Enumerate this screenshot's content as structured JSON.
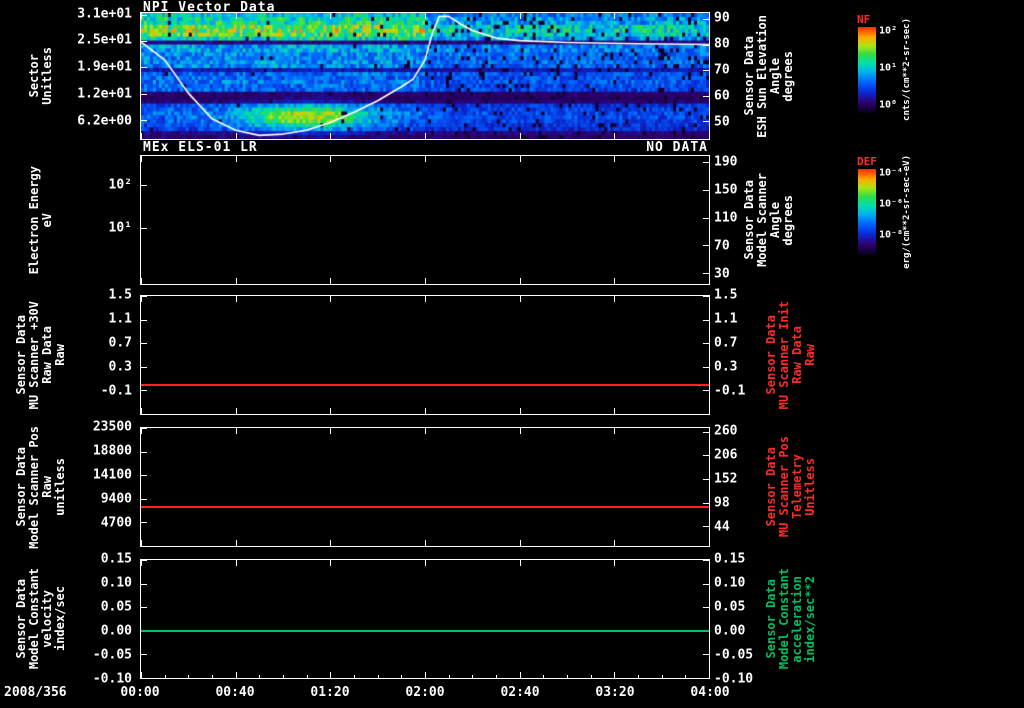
{
  "x_axis": {
    "date_label": "2008/356",
    "ticks": [
      {
        "t": "00:00",
        "p": 0
      },
      {
        "t": "00:40",
        "p": 16.67
      },
      {
        "t": "01:20",
        "p": 33.33
      },
      {
        "t": "02:00",
        "p": 50
      },
      {
        "t": "02:40",
        "p": 66.67
      },
      {
        "t": "03:20",
        "p": 83.33
      },
      {
        "t": "04:00",
        "p": 100
      }
    ]
  },
  "panels": [
    {
      "title": "NPI Vector Data",
      "left_label": [
        "Sector",
        "Unitless"
      ],
      "left_ticks": [
        {
          "t": "3.1e+01",
          "p": 1.6
        },
        {
          "t": "2.5e+01",
          "p": 21.9
        },
        {
          "t": "1.9e+01",
          "p": 43
        },
        {
          "t": "1.2e+01",
          "p": 64
        },
        {
          "t": "6.2e+00",
          "p": 85
        }
      ],
      "right_ticks": [
        {
          "t": "90",
          "p": 4.7
        },
        {
          "t": "80",
          "p": 25
        },
        {
          "t": "70",
          "p": 45.3
        },
        {
          "t": "60",
          "p": 65.6
        },
        {
          "t": "50",
          "p": 86
        }
      ],
      "right_label": [
        "Sensor Data",
        "ESH Sun Elevation",
        "Angle",
        "degrees"
      ],
      "right_label_color": "#ffffff"
    },
    {
      "title": "MEx ELS-01 LR",
      "status": "NO DATA",
      "left_label": [
        "Electron Energy",
        "eV"
      ],
      "left_ticks": [
        {
          "t": "10²",
          "p": 23
        },
        {
          "t": "10¹",
          "p": 56
        }
      ],
      "right_ticks": [
        {
          "t": "190",
          "p": 5
        },
        {
          "t": "150",
          "p": 26.6
        },
        {
          "t": "110",
          "p": 48.2
        },
        {
          "t": "70",
          "p": 69.8
        },
        {
          "t": "30",
          "p": 91.4
        }
      ],
      "right_label": [
        "Sensor Data",
        "Model Scanner",
        "Angle",
        "degrees"
      ],
      "right_label_color": "#ffffff"
    },
    {
      "left_label": [
        "Sensor Data",
        "MU Scanner +30V",
        "Raw Data",
        "Raw"
      ],
      "left_ticks": [
        {
          "t": "1.5",
          "p": 0
        },
        {
          "t": "1.1",
          "p": 20
        },
        {
          "t": "0.7",
          "p": 40
        },
        {
          "t": "0.3",
          "p": 60
        },
        {
          "t": "-0.1",
          "p": 80
        }
      ],
      "right_ticks": [
        {
          "t": "1.5",
          "p": 0
        },
        {
          "t": "1.1",
          "p": 20
        },
        {
          "t": "0.7",
          "p": 40
        },
        {
          "t": "0.3",
          "p": 60
        },
        {
          "t": "-0.1",
          "p": 80
        }
      ],
      "right_label": [
        "Sensor Data",
        "MU Scanner Init",
        "Raw Data",
        "Raw"
      ],
      "right_label_color": "#ff2a2a",
      "line": {
        "value": 0.0,
        "top": 1.5,
        "bottom": -0.5,
        "color": "#ff2020"
      }
    },
    {
      "left_label": [
        "Sensor Data",
        "Model Scanner Pos",
        "Raw",
        "unitless"
      ],
      "left_ticks": [
        {
          "t": "23500",
          "p": 0
        },
        {
          "t": "18800",
          "p": 20
        },
        {
          "t": "14100",
          "p": 40
        },
        {
          "t": "9400",
          "p": 60
        },
        {
          "t": "4700",
          "p": 80
        }
      ],
      "right_ticks": [
        {
          "t": "260",
          "p": 3.3
        },
        {
          "t": "206",
          "p": 23.3
        },
        {
          "t": "152",
          "p": 43.3
        },
        {
          "t": "98",
          "p": 63.3
        },
        {
          "t": "44",
          "p": 83.3
        }
      ],
      "right_label": [
        "Sensor Data",
        "MU Scanner Pos",
        "Telemetry",
        "Unitless"
      ],
      "right_label_color": "#ff2a2a",
      "line": {
        "value": 7800,
        "top": 23500,
        "bottom": 0,
        "color": "#ff2020"
      }
    },
    {
      "left_label": [
        "Sensor Data",
        "Model Constant",
        "velocity",
        "index/sec"
      ],
      "left_ticks": [
        {
          "t": "0.15",
          "p": 0
        },
        {
          "t": "0.10",
          "p": 20
        },
        {
          "t": "0.05",
          "p": 40
        },
        {
          "t": "0.00",
          "p": 60
        },
        {
          "t": "-0.05",
          "p": 80
        },
        {
          "t": "-0.10",
          "p": 100
        }
      ],
      "right_ticks": [
        {
          "t": "0.15",
          "p": 0
        },
        {
          "t": "0.10",
          "p": 20
        },
        {
          "t": "0.05",
          "p": 40
        },
        {
          "t": "0.00",
          "p": 60
        },
        {
          "t": "-0.05",
          "p": 80
        },
        {
          "t": "-0.10",
          "p": 100
        }
      ],
      "right_label": [
        "Sensor Data",
        "Model Constant",
        "acceleration",
        "index/sec**2"
      ],
      "right_label_color": "#00c060",
      "line": {
        "value": 0.0,
        "top": 0.15,
        "bottom": -0.1,
        "color": "#00c060"
      }
    }
  ],
  "colorbars": [
    {
      "name": "NF",
      "unit": "cnts/(cm**2-sr-sec)",
      "ticks": [
        {
          "t": "10²",
          "p": 0
        },
        {
          "t": "10¹",
          "p": 43
        },
        {
          "t": "10⁰",
          "p": 86
        }
      ]
    },
    {
      "name": "DEF",
      "unit": "erg/(cm**2-sr-sec-eV)",
      "ticks": [
        {
          "t": "10⁻⁴",
          "p": 0
        },
        {
          "t": "10⁻⁶",
          "p": 36
        },
        {
          "t": "10⁻⁸",
          "p": 72
        }
      ]
    }
  ],
  "chart_data": [
    {
      "type": "heatmap",
      "title": "NPI Vector Data",
      "ylabel": "Sector (Unitless)",
      "y_range": [
        0,
        32
      ],
      "y_tick_values": [
        31,
        24.8,
        18.6,
        12.4,
        6.2
      ],
      "x_time_range": [
        "00:00",
        "04:00"
      ],
      "date": "2008/356",
      "colorbar": {
        "name": "NF",
        "unit": "cnts/(cm**2-sr-sec)"
      },
      "right_axis": {
        "label": "Sensor Data ESH Sun Elevation Angle (degrees)",
        "ticks": [
          90,
          80,
          70,
          60,
          50
        ]
      },
      "heatmap_description": "32-sector ion count spectrogram: bright cyan band sectors 25-31 before 02:00; bright green-cyan blob sectors 1-9 between 00:20 and 01:30; dark stripes near sectors 9-11, 17 and 24; flatter blue field with black dropout speckle after 02:00",
      "overlay_line": {
        "name": "ESH Sun Elevation Angle",
        "color": "#ffffff",
        "x_minutes": [
          0,
          10,
          20,
          30,
          40,
          50,
          60,
          70,
          80,
          90,
          100,
          110,
          115,
          120,
          123,
          126,
          130,
          135,
          140,
          150,
          160,
          180,
          210,
          240
        ],
        "y_degrees": [
          81,
          74,
          61,
          51,
          46.5,
          44.5,
          45,
          46.5,
          49.5,
          53.5,
          58,
          63.5,
          66.5,
          74,
          84,
          91,
          91,
          88,
          85.5,
          82.5,
          81.5,
          80.8,
          80.3,
          80
        ]
      },
      "render": {
        "seed": 42,
        "cols": 190,
        "rows": 32,
        "band_gain": [
          0.12,
          0.15,
          0.28,
          0.3,
          0.33,
          0.35,
          0.35,
          0.33,
          0.3,
          0.12,
          0.1,
          0.12,
          0.34,
          0.36,
          0.38,
          0.36,
          0.36,
          0.2,
          0.4,
          0.42,
          0.4,
          0.42,
          0.45,
          0.45,
          0.14,
          0.5,
          0.6,
          0.66,
          0.62,
          0.52,
          0.5,
          0.45
        ],
        "blob": {
          "t_center": 0.29,
          "t_sigma": 0.11,
          "row_center": 5,
          "row_sigma": 3.2,
          "gain": 0.46
        },
        "right_dim_after_t": 0.5,
        "speckle_prob": 0.08
      }
    },
    {
      "type": "heatmap",
      "title": "MEx ELS-01 LR",
      "status": "NO DATA",
      "values": [],
      "ylabel": "Electron Energy (eV)",
      "y_ticks": [
        "10²",
        "10¹"
      ],
      "right_axis": {
        "label": "Sensor Data Model Scanner Angle (degrees)",
        "ticks": [
          190,
          150,
          110,
          70,
          30
        ]
      },
      "colorbar": {
        "name": "DEF",
        "unit": "erg/(cm**2-sr-sec-eV)"
      }
    },
    {
      "type": "line",
      "ylabel": "Sensor Data MU Scanner +30V Raw Data (Raw)",
      "ylim": [
        -0.5,
        1.5
      ],
      "y_ticks": [
        1.5,
        1.1,
        0.7,
        0.3,
        -0.1
      ],
      "series": [
        {
          "name": "Sensor Data MU Scanner Init Raw Data (Raw)",
          "color": "#ff2020",
          "constant_value": 0.0
        }
      ]
    },
    {
      "type": "line",
      "ylabel": "Sensor Data Model Scanner Pos Raw (unitless)",
      "ylim": [
        0,
        23500
      ],
      "y_ticks": [
        23500,
        18800,
        14100,
        9400,
        4700
      ],
      "right_ticks": [
        260,
        206,
        152,
        98,
        44
      ],
      "series": [
        {
          "name": "Sensor Data MU Scanner Pos Telemetry (Unitless)",
          "color": "#ff2020",
          "constant_value": 7800
        }
      ]
    },
    {
      "type": "line",
      "ylabel": "Sensor Data Model Constant velocity (index/sec)",
      "ylim": [
        -0.1,
        0.15
      ],
      "y_ticks": [
        0.15,
        0.1,
        0.05,
        0.0,
        -0.05,
        -0.1
      ],
      "series": [
        {
          "name": "Sensor Data Model Constant acceleration (index/sec**2)",
          "color": "#00c060",
          "constant_value": 0.0
        }
      ]
    }
  ]
}
